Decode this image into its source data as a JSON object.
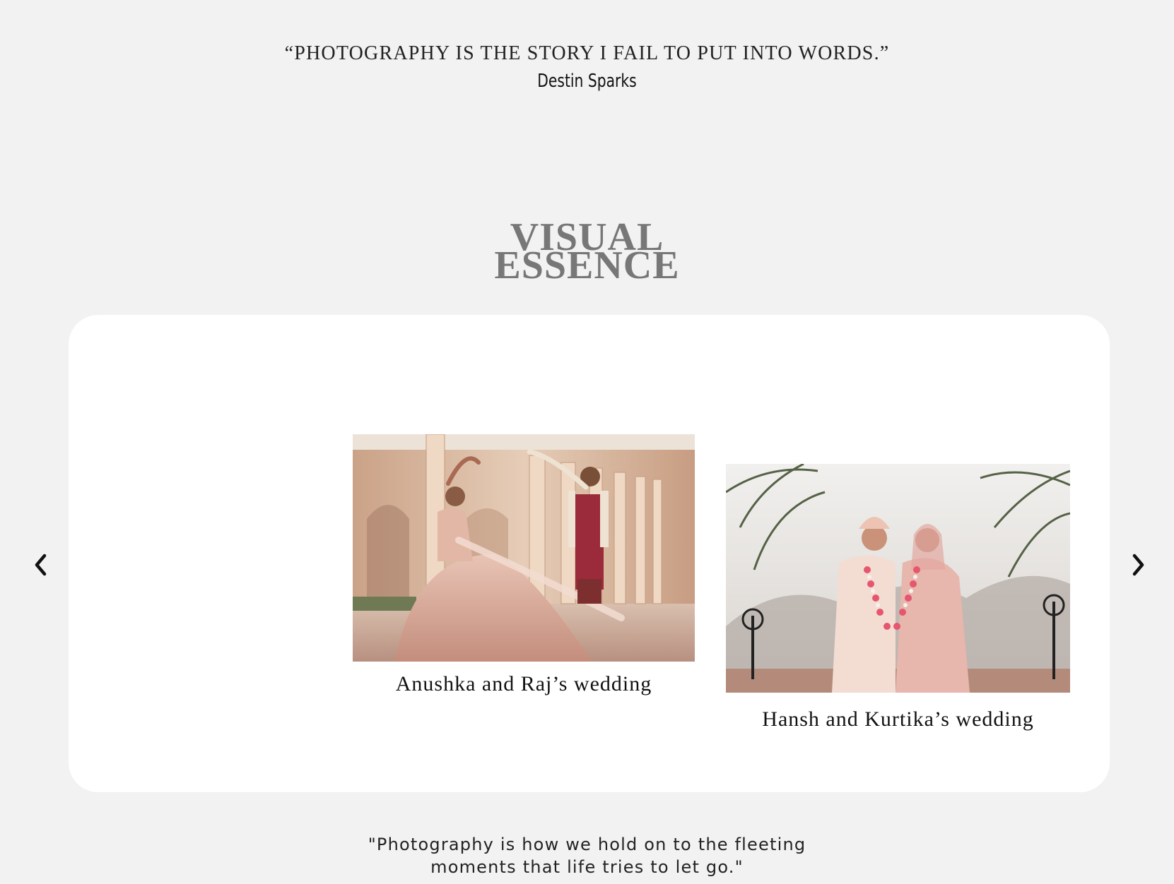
{
  "quote_top": {
    "text": "“PHOTOGRAPHY IS THE STORY I FAIL TO PUT INTO WORDS.”",
    "author": "Destin Sparks"
  },
  "section": {
    "title_line1": "VISUAL",
    "title_line2": "ESSENCE"
  },
  "carousel": {
    "prev_icon": "chevron-left-icon",
    "next_icon": "chevron-right-icon",
    "slides": [
      {
        "caption": "Anushka and Raj’s wedding",
        "image": "couple-dancing-palace-corridor-photo"
      },
      {
        "caption": "Hansh and Kurtika’s wedding",
        "image": "couple-garlands-palm-trees-photo"
      }
    ]
  },
  "quote_bottom": {
    "line1": "\"Photography is how we hold on to the fleeting",
    "line2": "moments that life tries to let go.\""
  },
  "colors": {
    "background": "#f2f2f2",
    "panel": "#ffffff",
    "title": "#777777",
    "text": "#111111"
  }
}
